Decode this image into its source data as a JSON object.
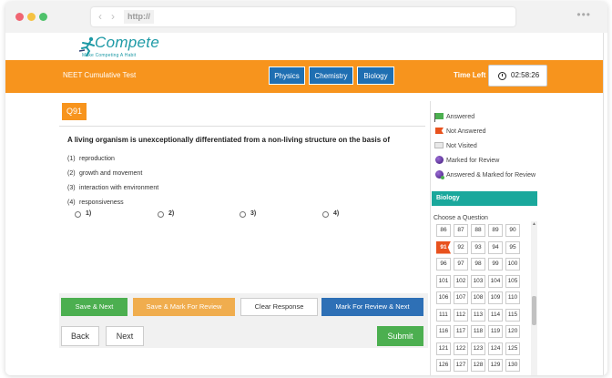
{
  "browser": {
    "url": "http://",
    "back_glyph": "‹",
    "forward_glyph": "›",
    "menu_glyph": "•••"
  },
  "logo": {
    "name": "Compete",
    "tagline": "Make Competing A Habit",
    "brand_color": "#1e9aa6"
  },
  "header": {
    "exam_title": "NEET Cumulative Test",
    "subjects": [
      "Physics",
      "Chemistry",
      "Biology"
    ],
    "time_left_label": "Time Left",
    "timer": "02:58:26",
    "accent_color": "#f7941d"
  },
  "question": {
    "number": "Q91",
    "text": "A living organism is unexceptionally differentiated from a non-living structure on the basis of",
    "options": [
      {
        "num": "(1)",
        "text": "reproduction"
      },
      {
        "num": "(2)",
        "text": "growth and movement"
      },
      {
        "num": "(3)",
        "text": "interaction with environment"
      },
      {
        "num": "(4)",
        "text": "responsiveness"
      }
    ],
    "answer_choices": [
      "1)",
      "2)",
      "3)",
      "4)"
    ]
  },
  "actions": {
    "save_next": "Save & Next",
    "save_mark_review": "Save & Mark For Review",
    "clear_response": "Clear Response",
    "mark_review_next": "Mark For Review & Next",
    "back": "Back",
    "next": "Next",
    "submit": "Submit"
  },
  "legend": {
    "answered": "Answered",
    "not_answered": "Not Answered",
    "not_visited": "Not Visited",
    "marked_for_review": "Marked for Review",
    "answered_marked": "Answered & Marked for Review"
  },
  "palette": {
    "section": "Biology",
    "choose_label": "Choose a Question",
    "current_question": "91",
    "rows": [
      [
        "86",
        "87",
        "88",
        "89",
        "90"
      ],
      [
        "91",
        "92",
        "93",
        "94",
        "95"
      ],
      [
        "96",
        "97",
        "98",
        "99",
        "100"
      ],
      [
        "101",
        "102",
        "103",
        "104",
        "105"
      ],
      [
        "106",
        "107",
        "108",
        "109",
        "110"
      ],
      [
        "111",
        "112",
        "113",
        "114",
        "115"
      ],
      [
        "116",
        "117",
        "118",
        "119",
        "120"
      ],
      [
        "121",
        "122",
        "123",
        "124",
        "125"
      ],
      [
        "126",
        "127",
        "128",
        "129",
        "130"
      ]
    ]
  }
}
